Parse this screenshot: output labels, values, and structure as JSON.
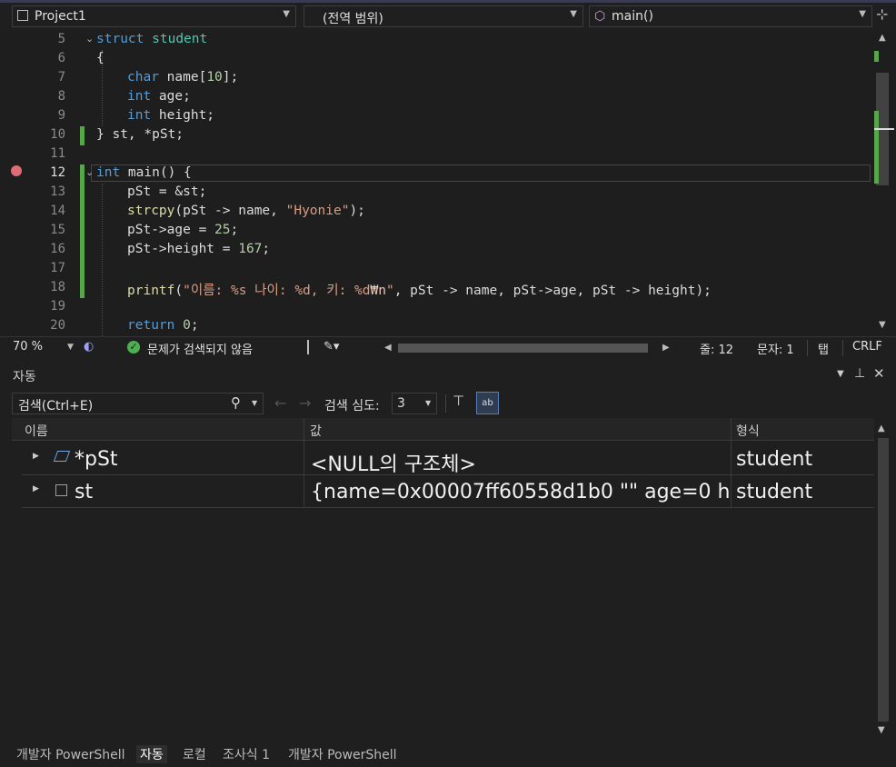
{
  "navbar": {
    "project": "Project1",
    "scope": "(전역 범위)",
    "function": "main()"
  },
  "editor": {
    "lines": [
      {
        "num": "5"
      },
      {
        "num": "6"
      },
      {
        "num": "7"
      },
      {
        "num": "8"
      },
      {
        "num": "9"
      },
      {
        "num": "10"
      },
      {
        "num": "11"
      },
      {
        "num": "12"
      },
      {
        "num": "13"
      },
      {
        "num": "14"
      },
      {
        "num": "15"
      },
      {
        "num": "16"
      },
      {
        "num": "17"
      },
      {
        "num": "18"
      },
      {
        "num": "19"
      },
      {
        "num": "20"
      }
    ],
    "code": {
      "l5_kw": "struct",
      "l5_ty": "student",
      "l6": "{",
      "l7_kw": "char",
      "l7_rest": " name[",
      "l7_num": "10",
      "l7_end": "];",
      "l8_kw": "int",
      "l8_rest": " age;",
      "l9_kw": "int",
      "l9_rest": " height;",
      "l10": "} st, *pSt;",
      "l12_kw": "int",
      "l12_rest": " main() {",
      "l13": "pSt = &st;",
      "l14_fn": "strcpy",
      "l14_a": "(pSt -> name, ",
      "l14_str": "\"Hyonie\"",
      "l14_b": ");",
      "l15_a": "pSt->age = ",
      "l15_num": "25",
      "l15_b": ";",
      "l16_a": "pSt->height = ",
      "l16_num": "167",
      "l16_b": ";",
      "l18_fn": "printf",
      "l18_a": "(",
      "l18_str": "\"이름: %s 나이: %d, 키: %d",
      "l18_esc": "₩n",
      "l18_q": "\"",
      "l18_b": ", pSt -> name, pSt->age, pSt -> height);",
      "l20_kw": "return",
      "l20_sp": " ",
      "l20_num": "0",
      "l20_b": ";"
    }
  },
  "statusbar": {
    "zoom": "70 %",
    "issues": "문제가 검색되지 않음",
    "line": "줄: 12",
    "char": "문자: 1",
    "tab": "탭",
    "eol": "CRLF"
  },
  "autos": {
    "title": "자동",
    "search_placeholder": "검색(Ctrl+E)",
    "depth_label": "검색 심도:",
    "depth_value": "3",
    "columns": {
      "name": "이름",
      "value": "값",
      "type": "형식"
    },
    "rows": [
      {
        "name": "*pSt",
        "value": "<NULL의 구조체>",
        "type": "student"
      },
      {
        "name": "st",
        "value": "{name=0x00007ff60558d1b0 \"\" age=0 h...",
        "type": "student"
      }
    ]
  },
  "tabs": [
    "개발자 PowerShell",
    "자동",
    "로컬",
    "조사식 1",
    "개발자 PowerShell"
  ],
  "colors": {
    "keyword": "#569cd6",
    "type": "#4ec9b0",
    "string": "#d69d85",
    "change_bar": "#57a64a",
    "breakpoint": "#e06c75"
  }
}
